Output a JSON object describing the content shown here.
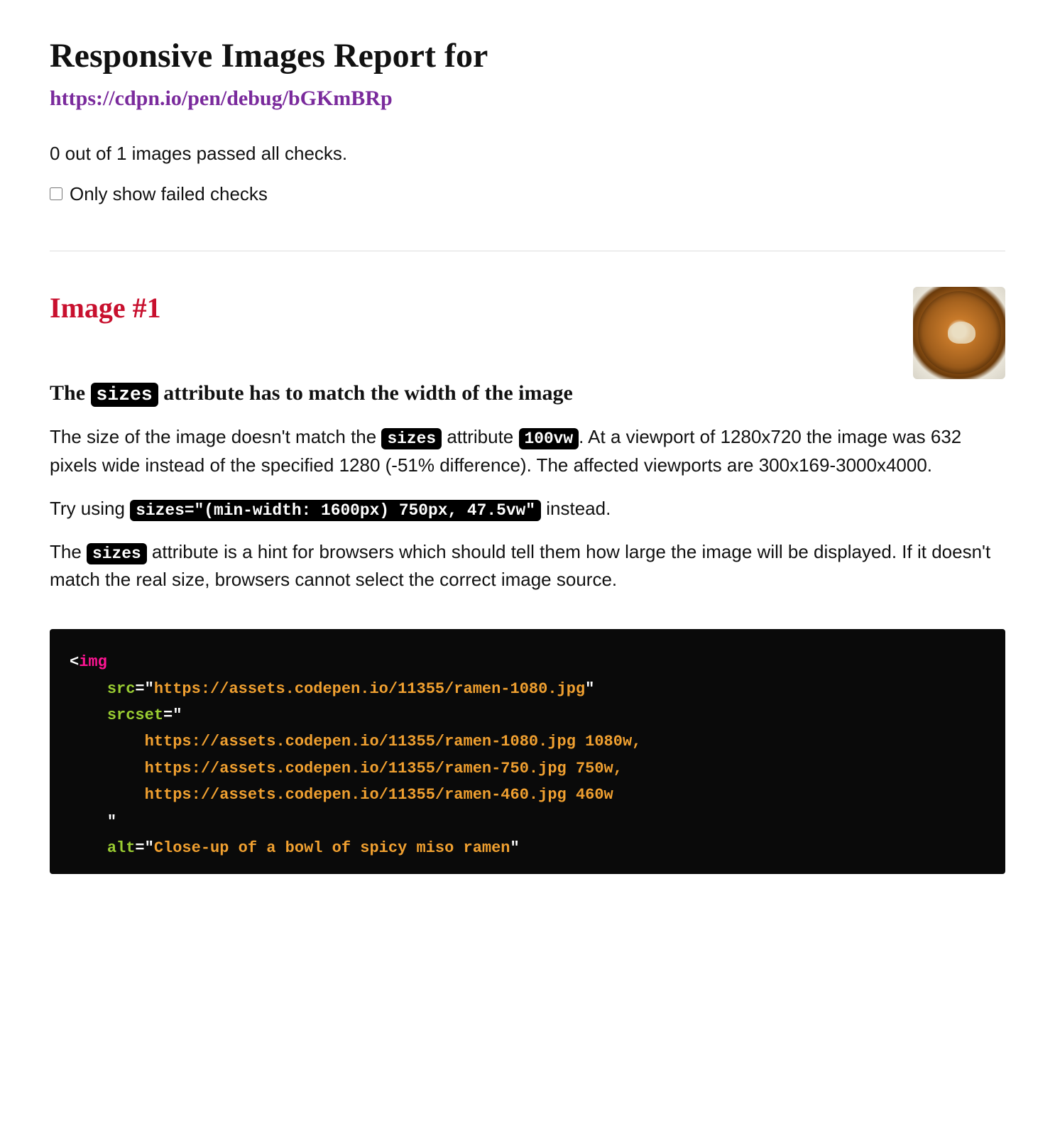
{
  "header": {
    "title": "Responsive Images Report for",
    "url": "https://cdpn.io/pen/debug/bGKmBRp"
  },
  "summary": "0 out of 1 images passed all checks.",
  "filter": {
    "label": "Only show failed checks"
  },
  "image": {
    "title": "Image #1",
    "check_heading": {
      "pre": "The ",
      "code": "sizes",
      "post": " attribute has to match the width of the image"
    },
    "para1": {
      "a": "The size of the image doesn't match the ",
      "code1": "sizes",
      "b": " attribute ",
      "code2": "100vw",
      "c": ". At a viewport of 1280x720 the image was 632 pixels wide instead of the specified 1280 (-51% difference). The affected viewports are 300x169-3000x4000."
    },
    "para2": {
      "a": "Try using ",
      "code": "sizes=\"(min-width: 1600px) 750px, 47.5vw\"",
      "b": " instead."
    },
    "para3": {
      "a": "The ",
      "code": "sizes",
      "b": " attribute is a hint for browsers which should tell them how large the image will be displayed. If it doesn't match the real size, browsers cannot select the correct image source."
    }
  },
  "code": {
    "tag": "img",
    "attrs": {
      "src": "src",
      "srcset": "srcset",
      "alt": "alt"
    },
    "src_val": "https://assets.codepen.io/11355/ramen-1080.jpg",
    "srcset_lines": [
      {
        "url": "https://assets.codepen.io/11355/ramen-1080.jpg",
        "w": "1080w",
        "comma": ","
      },
      {
        "url": "https://assets.codepen.io/11355/ramen-750.jpg",
        "w": "750w",
        "comma": ","
      },
      {
        "url": "https://assets.codepen.io/11355/ramen-460.jpg",
        "w": "460w",
        "comma": ""
      }
    ],
    "alt_val": "Close-up of a bowl of spicy miso ramen"
  }
}
